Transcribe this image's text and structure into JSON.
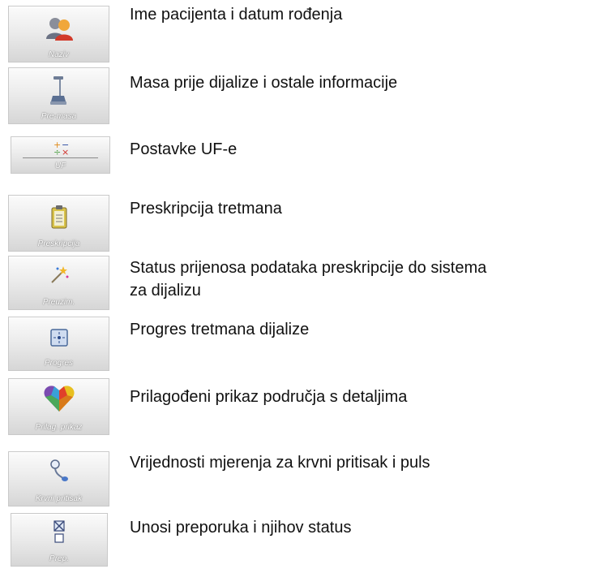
{
  "items": [
    {
      "button_label": "Naziv",
      "icon": "patients-icon",
      "description": "Ime pacijenta i datum rođenja"
    },
    {
      "button_label": "Pre-masa",
      "icon": "scale-icon",
      "description": "Masa prije dijalize i ostale informacije"
    },
    {
      "button_label": "UF",
      "icon": "uf-settings-icon",
      "description": "Postavke UF-e"
    },
    {
      "button_label": "Preskripcija",
      "icon": "clipboard-icon",
      "description": "Preskripcija tretmana"
    },
    {
      "button_label": "Preuzim.",
      "icon": "magic-wand-icon",
      "description": [
        "Status prijenosa podataka preskripcije do sistema",
        "za dijalizu"
      ]
    },
    {
      "button_label": "Progres",
      "icon": "progress-icon",
      "description": "Progres tretmana dijalize"
    },
    {
      "button_label": "Prilag. prikaz",
      "icon": "heart-mosaic-icon",
      "description": "Prilagođeni prikaz područja s detaljima"
    },
    {
      "button_label": "Krvni pritisak",
      "icon": "blood-pressure-icon",
      "description": "Vrijednosti mjerenja za krvni pritisak i puls"
    },
    {
      "button_label": "Prep.",
      "icon": "recommendation-icon",
      "description": "Unosi preporuka i njihov status"
    }
  ]
}
